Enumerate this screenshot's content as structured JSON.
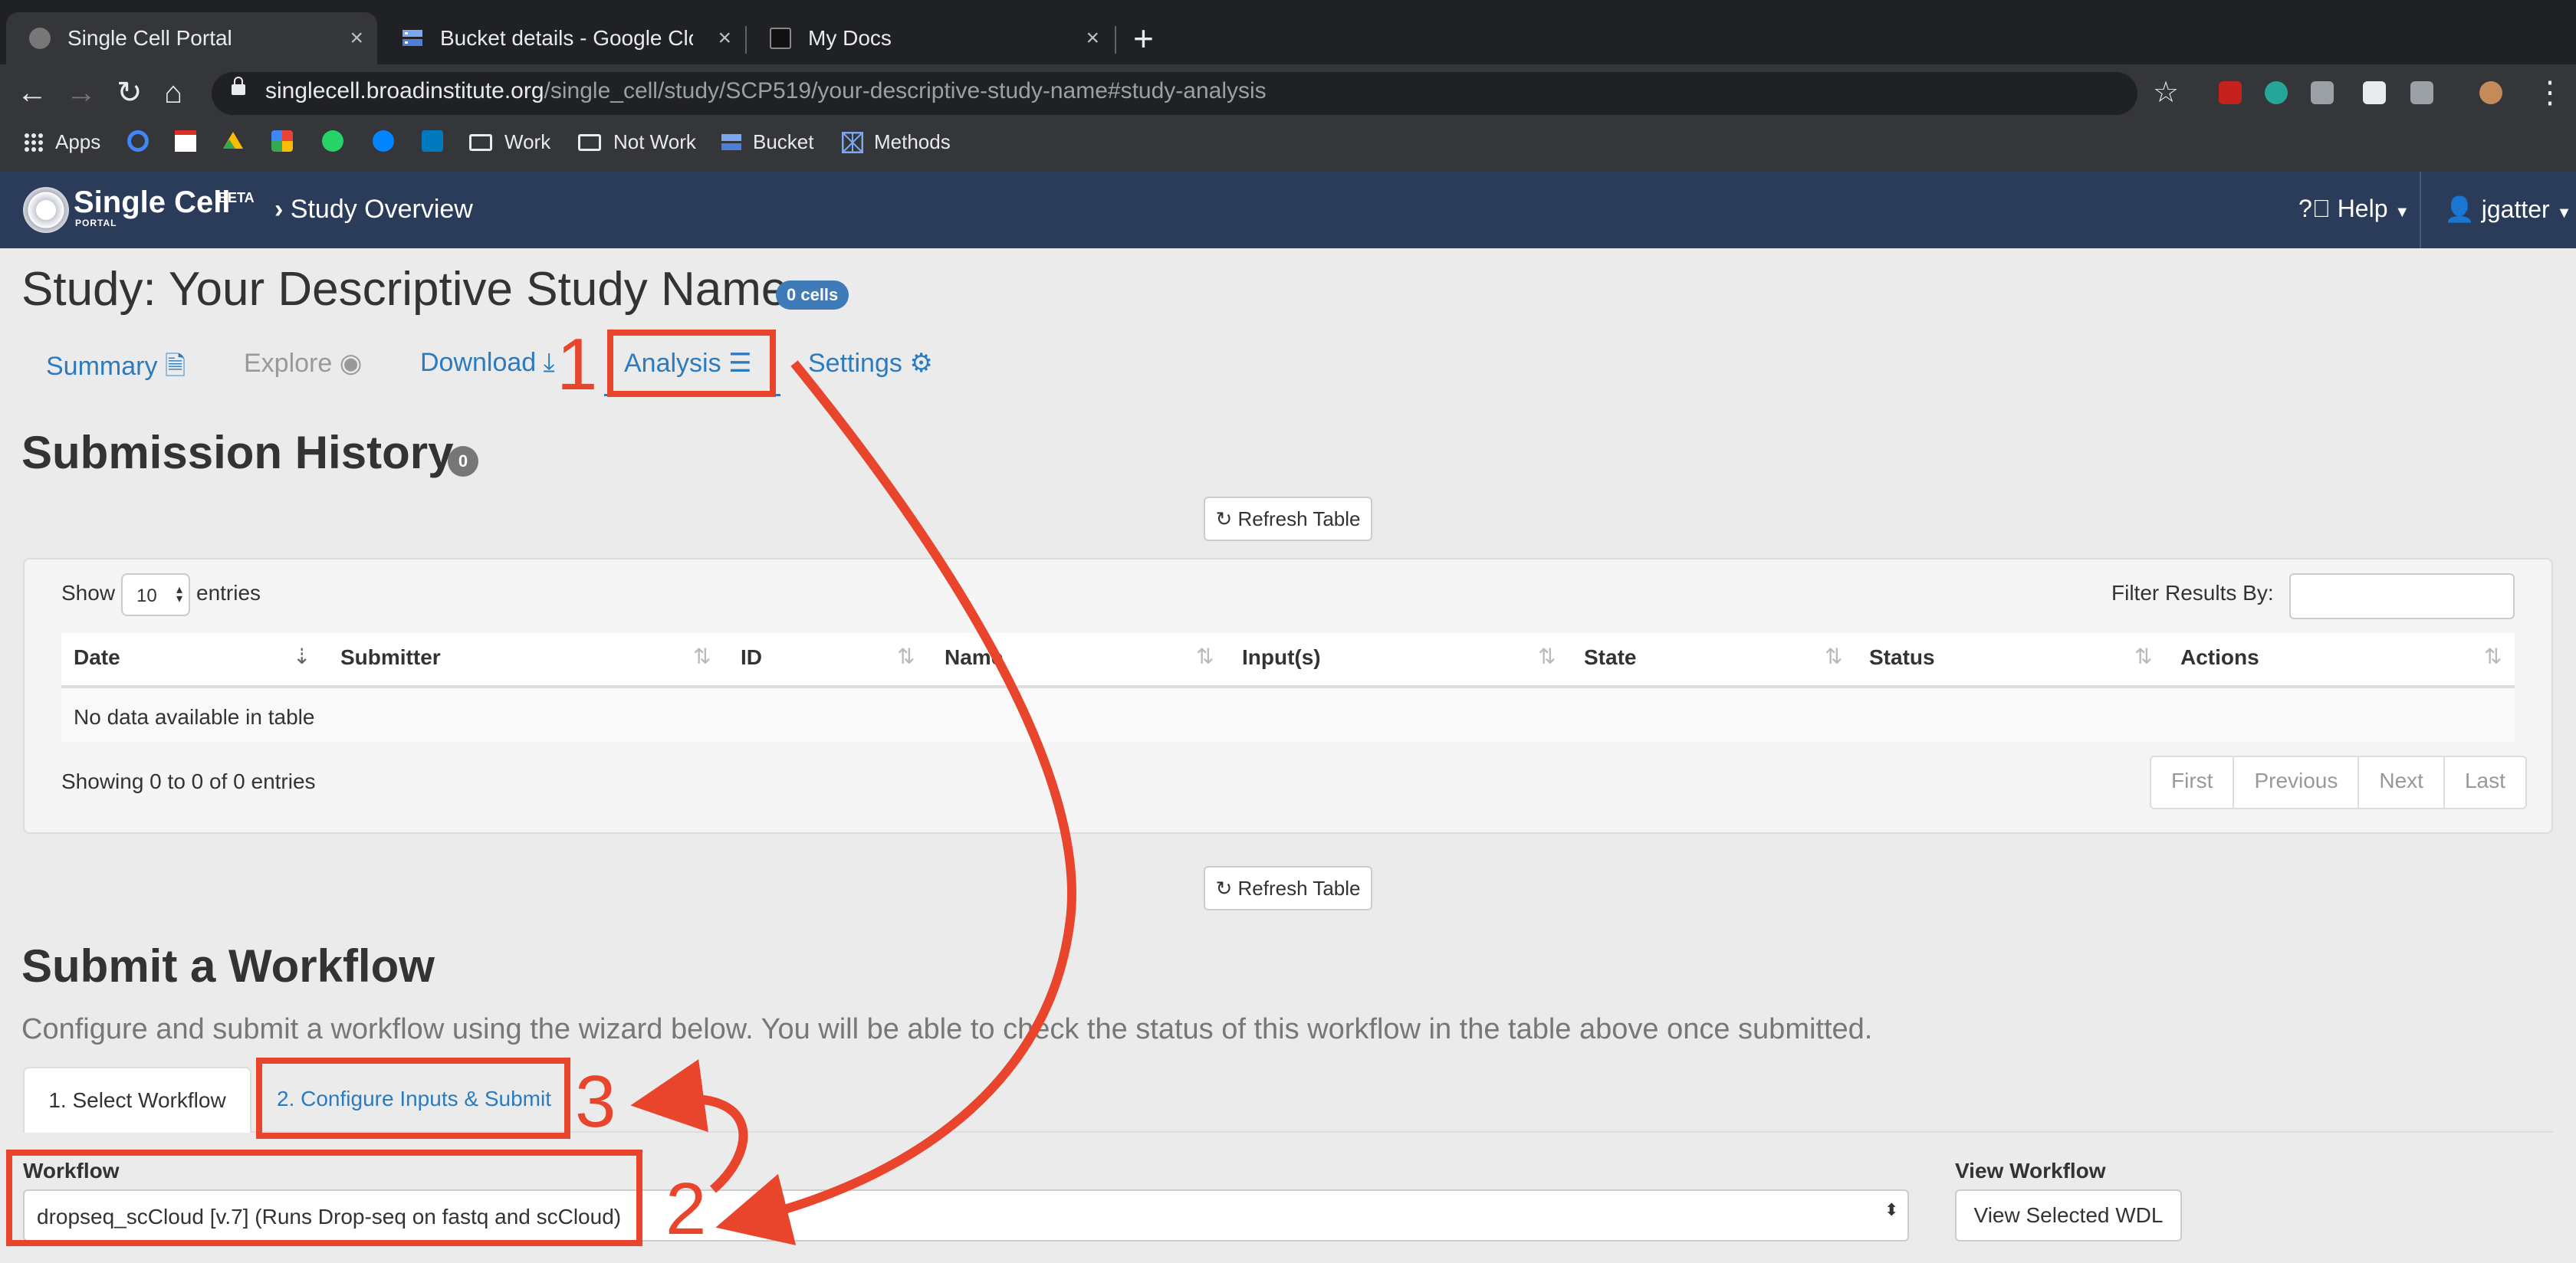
{
  "browser": {
    "tabs": [
      {
        "title": "Single Cell Portal",
        "close": "×"
      },
      {
        "title": "Bucket details - Google Cloud Platform",
        "close": "×"
      },
      {
        "title": "My Docs",
        "close": "×"
      }
    ],
    "new_tab": "+",
    "url_host": "singlecell.broadinstitute.org",
    "url_path": "/single_cell/study/SCP519/your-descriptive-study-name#study-analysis",
    "bookmarks": [
      "Apps",
      "Work",
      "Not Work",
      "Bucket",
      "Methods"
    ]
  },
  "app": {
    "logo": "Single Cell",
    "beta": "BETA",
    "portal": "PORTAL",
    "breadcrumb": "Study Overview",
    "help": "Help",
    "user": "jgatter",
    "accent_color": "#2c7bbf",
    "navbar_color": "#2b3b5a"
  },
  "study": {
    "title": "Study: Your Descriptive Study Name",
    "cells_badge": "0 cells",
    "tabs": {
      "summary": "Summary",
      "explore": "Explore",
      "download": "Download",
      "analysis": "Analysis",
      "settings": "Settings"
    }
  },
  "history": {
    "heading": "Submission History",
    "count": "0",
    "refresh": "Refresh Table",
    "show": "Show",
    "page_size": "10",
    "entries": "entries",
    "filter_label": "Filter Results By:",
    "columns": [
      "Date",
      "Submitter",
      "ID",
      "Name",
      "Input(s)",
      "State",
      "Status",
      "Actions"
    ],
    "empty": "No data available in table",
    "showing": "Showing 0 to 0 of 0 entries",
    "pager": [
      "First",
      "Previous",
      "Next",
      "Last"
    ]
  },
  "submit": {
    "heading": "Submit a Workflow",
    "description": "Configure and submit a workflow using the wizard below. You will be able to check the status of this workflow in the table above once submitted.",
    "step1": "1. Select Workflow",
    "step2": "2. Configure Inputs & Submit",
    "workflow_label": "Workflow",
    "workflow_value": "dropseq_scCloud [v.7] (Runs Drop-seq on fastq and scCloud)",
    "view_label": "View Workflow",
    "view_button": "View Selected WDL"
  },
  "annotations": {
    "n1": "1",
    "n2": "2",
    "n3": "3",
    "color": "#e8452c"
  }
}
